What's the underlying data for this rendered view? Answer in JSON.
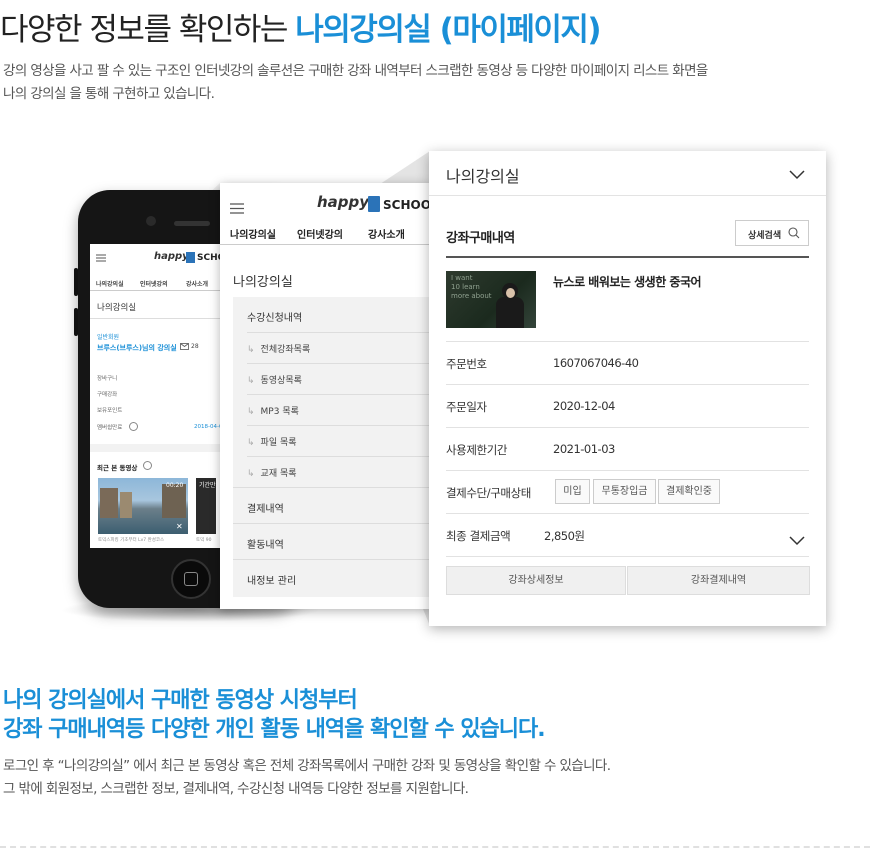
{
  "header": {
    "title_prefix": "다양한 정보를 확인하는 ",
    "title_accent": "나의강의실 (마이페이지)",
    "desc_line1": "강의 영상을 사고 팔 수 있는 구조인 인터넷강의 솔루션은 구매한 강좌 내역부터 스크랩한 동영상 등 다양한 마이페이지 리스트 화면을",
    "desc_line2": "나의 강의실 을 통해 구현하고 있습니다."
  },
  "colors": {
    "accent": "#1a8fd7"
  },
  "phone": {
    "logo": "happy",
    "logo_school": "SCHO",
    "menu": [
      "나의강의실",
      "인터넷강의",
      "강사소개"
    ],
    "page_title": "나의강의실",
    "member_type": "일반회원",
    "member_name": "브루스(브루스)님의 강의실",
    "msg_count": "28",
    "links": [
      "장바구니",
      "구매강좌",
      "보유포인트",
      "멤버쉽만료"
    ],
    "membership_date": "2018-04-0",
    "recent_title": "최근 본 동영상",
    "video_time": "00:20",
    "video_tag": "기간만",
    "video_caption": "토익스피킹 기초부터 Lv7 완성코스",
    "video_caption2": "토익 90"
  },
  "panel1": {
    "logo": "happy",
    "logo_school": "SCHOO",
    "menu": [
      "나의강의실",
      "인터넷강의",
      "강사소개"
    ],
    "title": "나의강의실",
    "section1": "수강신청내역",
    "subs": [
      "전체강좌목록",
      "동영상목록",
      "MP3 목록",
      "파일 목록",
      "교재 목록"
    ],
    "section2": "결제내역",
    "section3": "활동내역",
    "section4": "내정보 관리"
  },
  "panel2": {
    "title": "나의강의실",
    "section": "강좌구매내역",
    "search_label": "상세검색",
    "thumb_text": "I want\n10 learn\nmore about",
    "course_title": "뉴스로 배워보는 생생한 중국어",
    "rows": [
      {
        "label": "주문번호",
        "value": "1607067046-40"
      },
      {
        "label": "주문일자",
        "value": "2020-12-04"
      },
      {
        "label": "사용제한기간",
        "value": "2021-01-03"
      }
    ],
    "payment_label": "결제수단/구매상태",
    "tags": [
      "미입",
      "무통장입금",
      "결제확인중"
    ],
    "total_label": "최종 결제금액",
    "total_value": "2,850원",
    "btn_detail": "강좌상세정보",
    "btn_payment": "강좌결제내역"
  },
  "bottom": {
    "head1": "나의 강의실에서 구매한 동영상 시청부터",
    "head2": "강좌 구매내역등 다양한 개인 활동 내역을 확인할 수 있습니다.",
    "desc1": "로그인 후 “나의강의실” 에서 최근 본 동영상 혹은 전체 강좌목록에서 구매한 강좌 및 동영상을 확인할 수 있습니다.",
    "desc2": "그 밖에 회원정보, 스크랩한 정보, 결제내역, 수강신청 내역등 다양한 정보를 지원합니다."
  }
}
